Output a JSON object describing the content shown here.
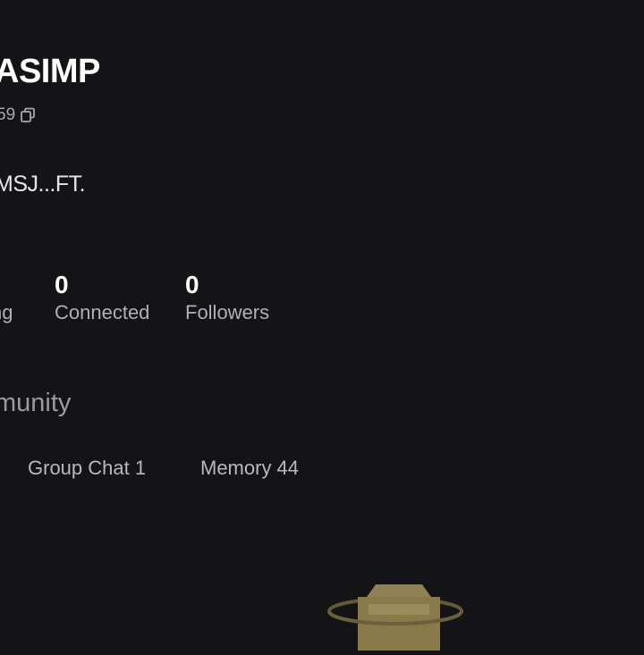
{
  "profile": {
    "username": "ASIMP",
    "id_fragment": "59",
    "bio": "MSJ...FT."
  },
  "stats": {
    "following": {
      "label": "ng"
    },
    "connected": {
      "count": "0",
      "label": "Connected"
    },
    "followers": {
      "count": "0",
      "label": "Followers"
    }
  },
  "community": {
    "title": "munity",
    "tabs": [
      {
        "label": "Group Chat 1"
      },
      {
        "label": "Memory 44"
      }
    ]
  },
  "icons": {
    "copy": "copy-icon",
    "empty_state": "empty-box-illustration"
  },
  "colors": {
    "background": "#141416",
    "accent_gold": "#8a7a4a"
  }
}
